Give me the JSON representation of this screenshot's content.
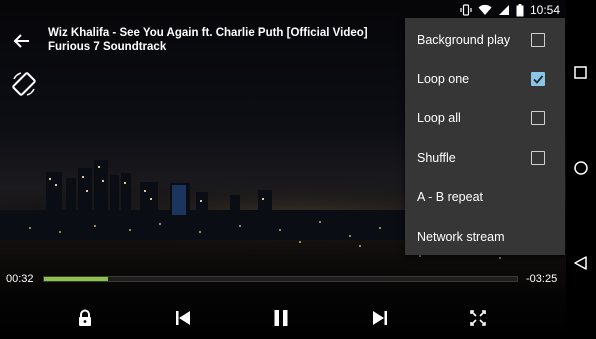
{
  "status_bar": {
    "time": "10:54",
    "icons": [
      "vibrate-icon",
      "wifi-icon",
      "signal-icon",
      "battery-icon"
    ]
  },
  "video": {
    "title": "Wiz Khalifa - See You Again ft. Charlie Puth [Official Video] Furious 7 Soundtrack"
  },
  "menu": {
    "items": [
      {
        "label": "Background play",
        "checkbox": true,
        "checked": false
      },
      {
        "label": "Loop one",
        "checkbox": true,
        "checked": true
      },
      {
        "label": "Loop all",
        "checkbox": true,
        "checked": false
      },
      {
        "label": "Shuffle",
        "checkbox": true,
        "checked": false
      },
      {
        "label": "A - B repeat",
        "checkbox": false
      },
      {
        "label": "Network stream",
        "checkbox": false
      }
    ]
  },
  "player": {
    "elapsed": "00:32",
    "remaining": "-03:25",
    "progress_fraction": 0.135,
    "state": "playing"
  },
  "colors": {
    "accent": "#8bc34a",
    "checkbox_checked": "#89c5e6",
    "menu_background": "#363636"
  },
  "nav_bar": {
    "icons": [
      "recents-icon",
      "home-icon",
      "back-nav-icon"
    ]
  }
}
